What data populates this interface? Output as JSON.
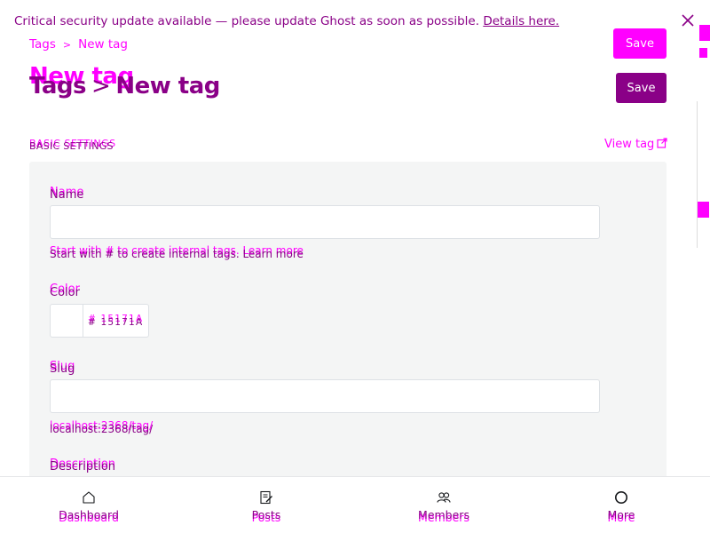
{
  "banner": {
    "message": "Critical security update available — please update Ghost as soon as possible.",
    "link": "Details here."
  },
  "breadcrumb": {
    "parent": "Tags",
    "separator": ">",
    "current": "New tag"
  },
  "header": {
    "ghost_title": "New tag",
    "title_parent": "Tags",
    "title_separator": ">",
    "title_current": "New tag",
    "save_label": "Save"
  },
  "section": {
    "ghost_heading": "BASIC SETTINGS",
    "heading": "BASIC SETTINGS",
    "view_tag": "View tag"
  },
  "form": {
    "name": {
      "label": "Name",
      "value": "",
      "hint_ghost": "Start with # to create internal tags. Learn more",
      "hint": "Start with # to create internal tags. Learn more"
    },
    "color": {
      "label": "Color",
      "value_ghost": "# 15171A",
      "value": "# 15171A"
    },
    "slug": {
      "label": "Slug",
      "value": "",
      "url_ghost": "localhost:2368/tag/",
      "url": "localhost:2368/tag/"
    },
    "description": {
      "label": "Description"
    }
  },
  "nav": {
    "items": [
      {
        "label": "Dashboard",
        "icon": "home-icon"
      },
      {
        "label": "Posts",
        "icon": "posts-icon"
      },
      {
        "label": "Members",
        "icon": "members-icon"
      },
      {
        "label": "More",
        "icon": "more-icon"
      }
    ]
  },
  "colors": {
    "accent": "#8a0087",
    "highlight": "#ff00ff",
    "panel": "#f4f5f5"
  }
}
